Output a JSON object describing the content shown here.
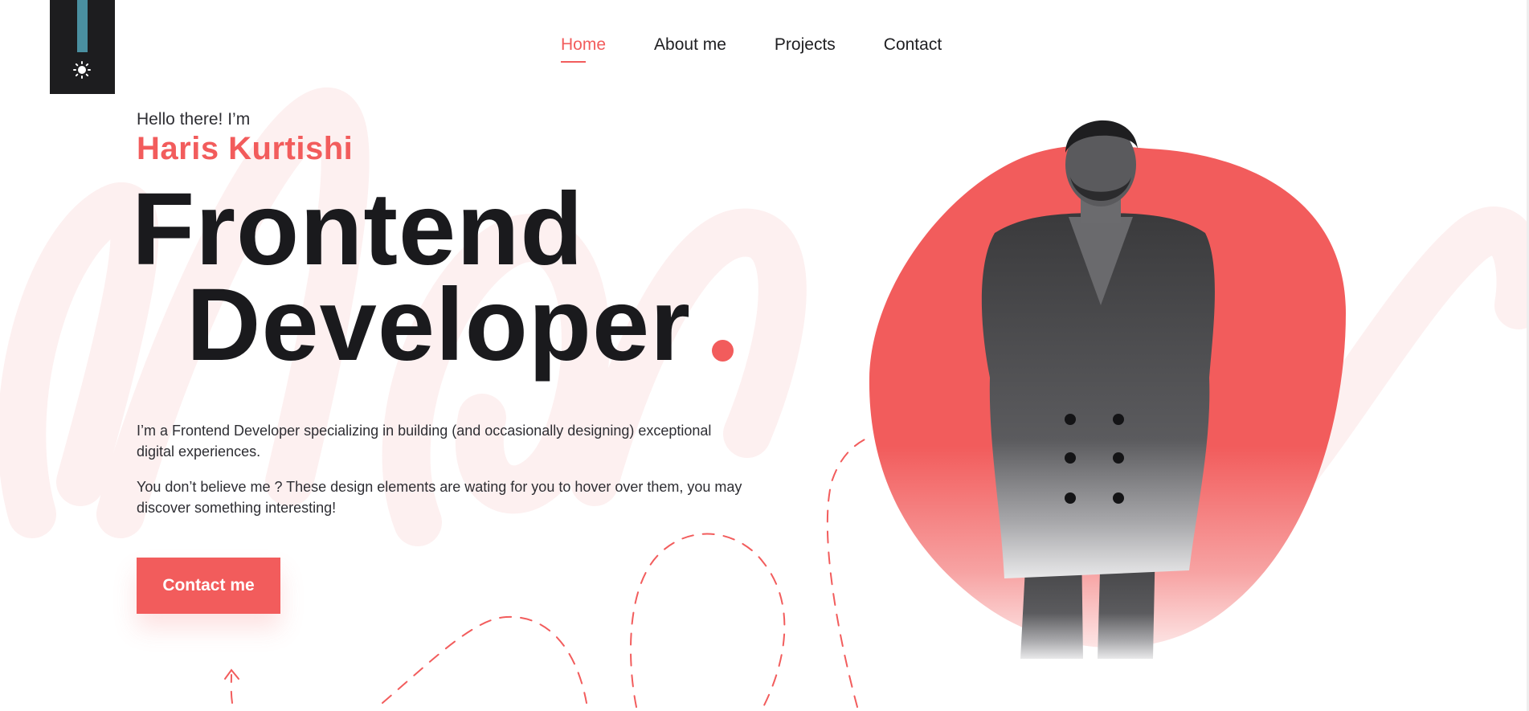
{
  "theme_toggle": {
    "icon": "sun-icon"
  },
  "nav": {
    "items": [
      {
        "label": "Home",
        "active": true
      },
      {
        "label": "About me",
        "active": false
      },
      {
        "label": "Projects",
        "active": false
      },
      {
        "label": "Contact",
        "active": false
      }
    ]
  },
  "hero": {
    "greeting": "Hello there! I’m",
    "name": "Haris Kurtishi",
    "headline_line1": "Frontend",
    "headline_line2": "Developer",
    "intro": "I’m a Frontend Developer specializing in building (and occasionally designing) exceptional digital experiences.",
    "intro_2": "You don’t believe me ? These design elements are wating for you to hover over them, you may discover something interesting!",
    "cta_label": "Contact me"
  },
  "colors": {
    "accent": "#f25c5c",
    "text_dark": "#1a1a1d",
    "panel_dark": "#1d1d1f",
    "theme_bar": "#4a8fa0",
    "background_script": "#fdf0f0"
  }
}
